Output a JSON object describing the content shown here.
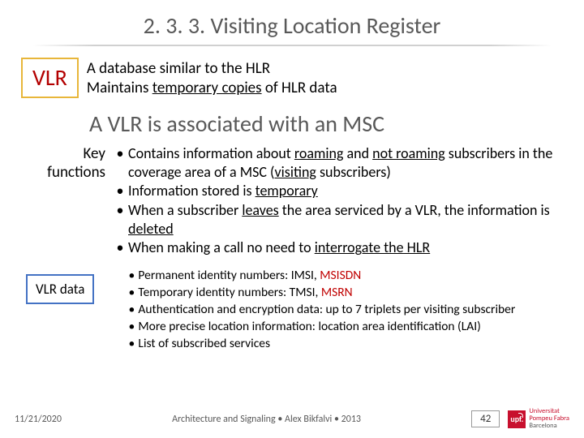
{
  "title": "2. 3. 3. Visiting Location Register",
  "vlr_label": "VLR",
  "def_line1": "A database similar to the HLR",
  "def_line2_a": "Maintains ",
  "def_line2_b": "temporary copies",
  "def_line2_c": " of HLR data",
  "assoc": "A VLR is associated with an MSC",
  "kf_label1": "Key",
  "kf_label2": "functions",
  "kf": {
    "b0a": "Contains information about ",
    "b0b": "roaming",
    "b0c": " and ",
    "b0d": "not roaming",
    "b0e": " subscribers in the coverage area of a MSC (",
    "b0f": "visiting",
    "b0g": " subscribers)",
    "b1a": "Information stored is ",
    "b1b": "temporary",
    "b2a": "When a subscriber ",
    "b2b": "leaves",
    "b2c": " the area serviced by a VLR, the information is ",
    "b2d": "deleted",
    "b3a": "When making a call no need to ",
    "b3b": "interrogate the HLR"
  },
  "data_label": "VLR data",
  "data": {
    "d0a": "Permanent identity numbers: IMSI, ",
    "d0b": "MSISDN",
    "d1a": "Temporary identity numbers: TMSI, ",
    "d1b": "MSRN",
    "d2": "Authentication and encryption data: up to 7 triplets per visiting subscriber",
    "d3": "More precise location information: location area identification (LAI)",
    "d4": "List of subscribed services"
  },
  "footer": {
    "date": "11/21/2020",
    "center": "Architecture and Signaling • Alex Bikfalvi • 2013",
    "page": "42",
    "logo_abbr": "upf.",
    "logo_line1": "Universitat",
    "logo_line2": "Pompeu Fabra",
    "logo_line3": "Barcelona"
  }
}
